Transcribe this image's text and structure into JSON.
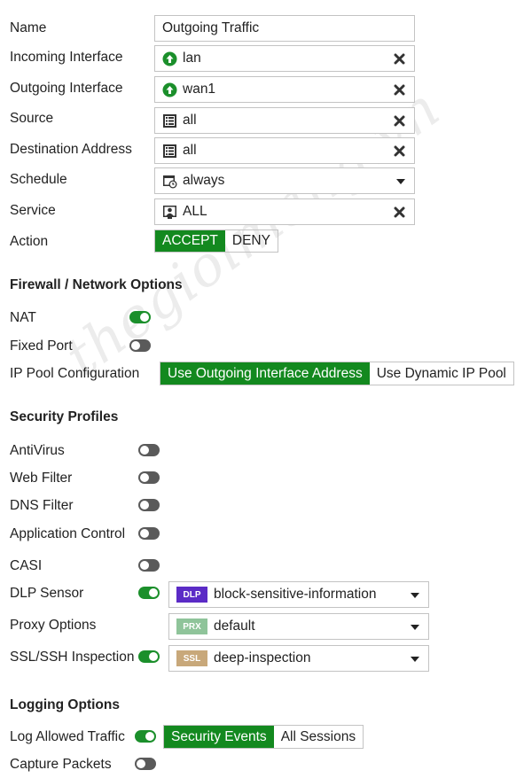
{
  "form": {
    "name_label": "Name",
    "name_value": "Outgoing Traffic",
    "incoming_label": "Incoming Interface",
    "incoming_value": "lan",
    "outgoing_label": "Outgoing Interface",
    "outgoing_value": "wan1",
    "source_label": "Source",
    "source_value": "all",
    "destination_label": "Destination Address",
    "destination_value": "all",
    "schedule_label": "Schedule",
    "schedule_value": "always",
    "service_label": "Service",
    "service_value": "ALL",
    "action_label": "Action",
    "action_options": [
      "ACCEPT",
      "DENY"
    ],
    "action_selected": "ACCEPT"
  },
  "firewall": {
    "title": "Firewall / Network Options",
    "nat_label": "NAT",
    "nat_on": true,
    "fixed_port_label": "Fixed Port",
    "fixed_port_on": false,
    "ip_pool_label": "IP Pool Configuration",
    "ip_pool_options": [
      "Use Outgoing Interface Address",
      "Use Dynamic IP Pool"
    ],
    "ip_pool_selected": "Use Outgoing Interface Address"
  },
  "security": {
    "title": "Security Profiles",
    "antivirus_label": "AntiVirus",
    "antivirus_on": false,
    "webfilter_label": "Web Filter",
    "webfilter_on": false,
    "dnsfilter_label": "DNS Filter",
    "dnsfilter_on": false,
    "appcontrol_label": "Application Control",
    "appcontrol_on": false,
    "casi_label": "CASI",
    "casi_on": false,
    "dlp_label": "DLP Sensor",
    "dlp_on": true,
    "dlp_badge": "DLP",
    "dlp_value": "block-sensitive-information",
    "proxy_label": "Proxy Options",
    "proxy_badge": "PRX",
    "proxy_value": "default",
    "ssl_label": "SSL/SSH Inspection",
    "ssl_on": true,
    "ssl_badge": "SSL",
    "ssl_value": "deep-inspection"
  },
  "logging": {
    "title": "Logging Options",
    "log_allowed_label": "Log Allowed Traffic",
    "log_allowed_on": true,
    "log_options": [
      "Security Events",
      "All Sessions"
    ],
    "log_selected": "Security Events",
    "capture_label": "Capture Packets",
    "capture_on": false
  },
  "colors": {
    "accent_green": "#13891f",
    "dlp_badge": "#5b2bc6",
    "prx_badge": "#8fc49a",
    "ssl_badge": "#c8a87a"
  },
  "icons": {
    "interface": "arrow-up-circle-icon",
    "address": "address-list-icon",
    "schedule": "calendar-clock-icon",
    "service": "service-user-icon",
    "clear": "close-icon",
    "dropdown": "chevron-down-icon"
  },
  "watermark_text": "thegioimang.vn"
}
